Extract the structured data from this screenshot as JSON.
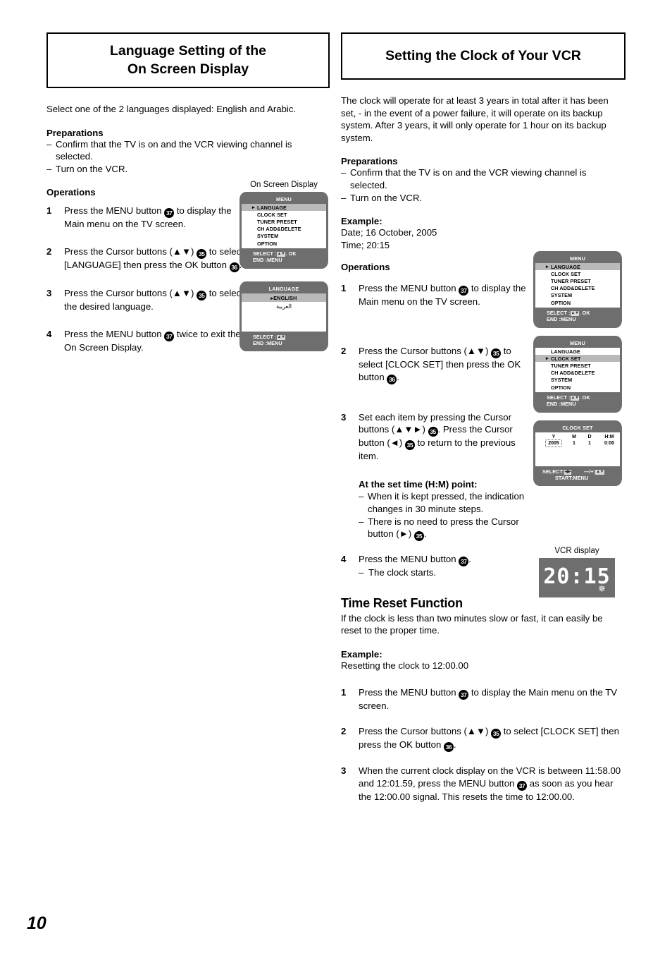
{
  "page": {
    "number": "10"
  },
  "left": {
    "title": "Language Setting of the\nOn Screen Display",
    "title_line1": "Language Setting of the",
    "title_line2": "On Screen Display",
    "intro": "Select one of the 2 languages displayed: English and Arabic.",
    "preparations_heading": "Preparations",
    "preparations": [
      "Confirm that the TV is on and the VCR viewing channel is selected.",
      "Turn on the VCR."
    ],
    "operations_heading": "Operations",
    "steps": [
      {
        "num": "1",
        "pre": "Press the MENU button ",
        "badge": "37",
        "post": " to display the Main menu on the TV screen."
      },
      {
        "num": "2",
        "pre": "Press the Cursor buttons (▲▼) ",
        "badge": "35",
        "post": " to select [LANGUAGE] then press the OK button ",
        "badge2": "36",
        "post2": "."
      },
      {
        "num": "3",
        "pre": "Press the Cursor buttons (▲▼) ",
        "badge": "35",
        "post": " to select the desired language."
      },
      {
        "num": "4",
        "pre": "Press the MENU button ",
        "badge": "37",
        "post": " twice to exit the On Screen Display."
      }
    ],
    "osd_caption": "On Screen Display"
  },
  "right": {
    "title": "Setting the Clock of Your VCR",
    "intro": "The clock will operate for at least 3 years in total after it has been set, - in the event of a power failure, it will operate on its backup system. After 3 years, it will only operate for 1 hour on its backup system.",
    "preparations_heading": "Preparations",
    "preparations": [
      "Confirm that the TV is on and the VCR viewing channel is selected.",
      "Turn on the VCR."
    ],
    "example_heading": "Example:",
    "example_date": "Date;  16 October, 2005",
    "example_time": "Time;  20:15",
    "operations_heading": "Operations",
    "steps": [
      {
        "num": "1",
        "pre": "Press the MENU button ",
        "badge": "37",
        "post": " to display the Main menu on the TV screen."
      },
      {
        "num": "2",
        "pre": "Press the Cursor buttons (▲▼) ",
        "badge": "35",
        "post": " to select [CLOCK SET] then press the OK button ",
        "badge2": "36",
        "post2": "."
      },
      {
        "num": "3",
        "pre": "Set each item by pressing the Cursor buttons (▲▼►) ",
        "badge": "35",
        "post": ". Press the Cursor button (◄) ",
        "badge2": "35",
        "post2": " to return to the previous item."
      },
      {
        "num": "4",
        "pre": "Press the MENU button ",
        "badge": "37",
        "post": "."
      }
    ],
    "step4_sub": "The clock starts.",
    "set_time_heading": "At the set time (H:M) point:",
    "set_time_bullets": [
      "When it is kept pressed, the indication changes in 30 minute steps.",
      "There is no need to press the Cursor button (►) "
    ],
    "set_time_bullet2_badge": "35",
    "set_time_bullet2_post": ".",
    "vcr_caption": "VCR display",
    "vcr_time": "20:15",
    "time_reset": {
      "heading": "Time Reset Function",
      "intro": "If the clock is less than two minutes slow or fast, it can easily be reset to the proper time.",
      "example_heading": "Example:",
      "example_text": "Resetting the clock to 12:00.00",
      "steps": [
        {
          "num": "1",
          "pre": "Press the MENU button ",
          "badge": "37",
          "post": " to display the Main menu on the TV screen."
        },
        {
          "num": "2",
          "pre": "Press the Cursor buttons (▲▼) ",
          "badge": "35",
          "post": " to select [CLOCK SET] then press the OK button ",
          "badge2": "36",
          "post2": "."
        },
        {
          "num": "3",
          "pre": "When the current clock display on the VCR is between 11:58.00 and 12:01.59, press the MENU button ",
          "badge": "37",
          "post": " as soon as you hear the 12:00.00 signal. This resets the time to 12:00.00."
        }
      ]
    }
  },
  "osd": {
    "menu_title": "MENU",
    "menu_items": [
      "LANGUAGE",
      "CLOCK SET",
      "TUNER PRESET",
      "CH ADD&DELETE",
      "SYSTEM",
      "OPTION"
    ],
    "menu_selected_language": 0,
    "menu_selected_clockset": 1,
    "footer_select_label": "SELECT :",
    "footer_select_ok": ". OK",
    "footer_end": "END      :MENU",
    "language_title": "LANGUAGE",
    "language_items": [
      "ENGLISH",
      "العربية"
    ],
    "language_footer_select": "SELECT :",
    "language_footer_end": "END     :MENU",
    "clockset_title": "CLOCK SET",
    "clockset_headers": [
      "Y",
      "M",
      "D",
      "H:M"
    ],
    "clockset_values": [
      "2005",
      "1",
      "1",
      "0:00"
    ],
    "clockset_footer_select": "SELECT:",
    "clockset_footer_plusminus": "—/+:",
    "clockset_footer_start": "START:MENU"
  },
  "colors": {
    "tv_bezel": "#6e6e6e",
    "tv_highlight": "#b9b9b9",
    "text": "#000000"
  }
}
